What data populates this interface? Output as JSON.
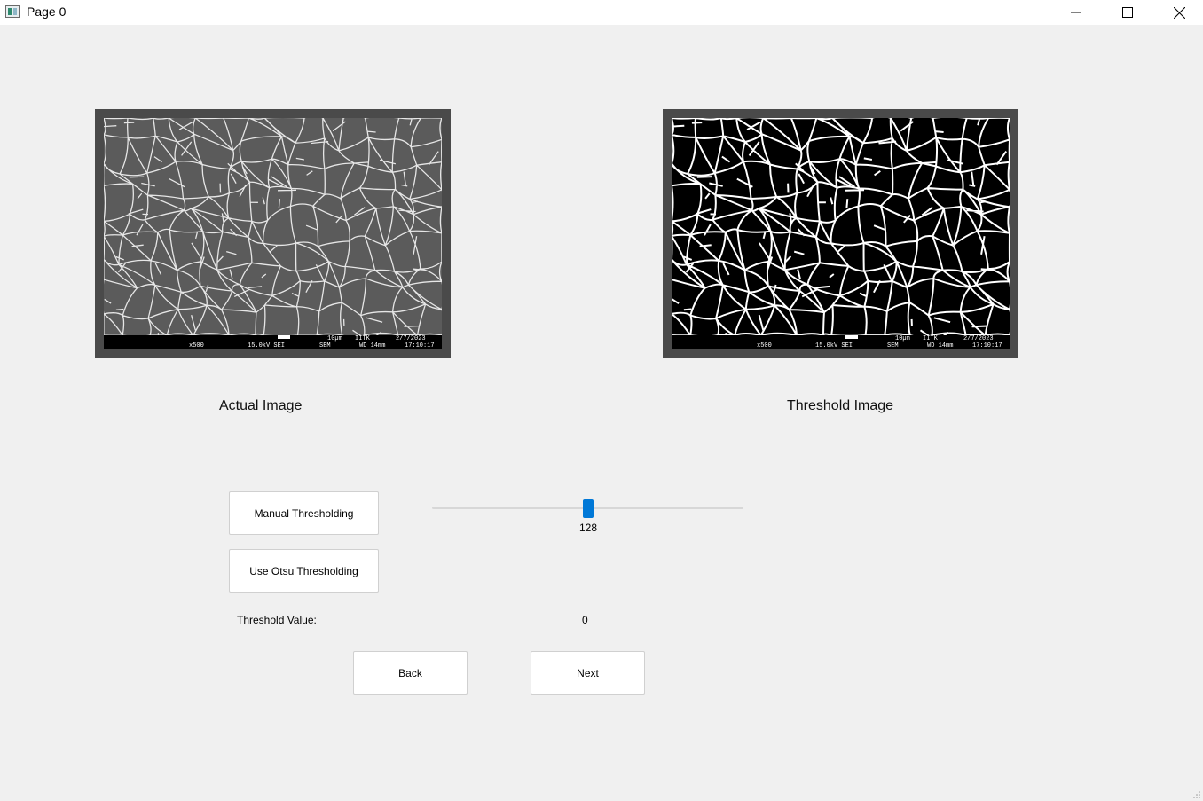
{
  "window": {
    "title": "Page 0",
    "controls": {
      "minimize": "minimize",
      "maximize": "maximize",
      "close": "close"
    }
  },
  "images": {
    "actual": {
      "caption": "Actual Image",
      "databar": {
        "mag": "x500",
        "kv": "15.0kV SEI",
        "mode": "SEM",
        "scale": "10µm",
        "wd": "WD 14mm",
        "org": "IITK",
        "date": "2/7/2023",
        "time": "17:10:17"
      }
    },
    "threshold": {
      "caption": "Threshold Image",
      "databar": {
        "mag": "x500",
        "kv": "15.0kV SEI",
        "mode": "SEM",
        "scale": "10µm",
        "wd": "WD 14mm",
        "org": "IITK",
        "date": "2/7/2023",
        "time": "17:10:17"
      }
    }
  },
  "controls": {
    "manual_label": "Manual Thresholding",
    "otsu_label": "Use Otsu Thresholding",
    "slider": {
      "value": "128",
      "min": 0,
      "max": 255
    },
    "threshold_label": "Threshold Value:",
    "threshold_value": "0",
    "back_label": "Back",
    "next_label": "Next"
  },
  "colors": {
    "accent": "#0078d7",
    "background": "#f0f0f0",
    "frame": "#4a4a4a"
  }
}
